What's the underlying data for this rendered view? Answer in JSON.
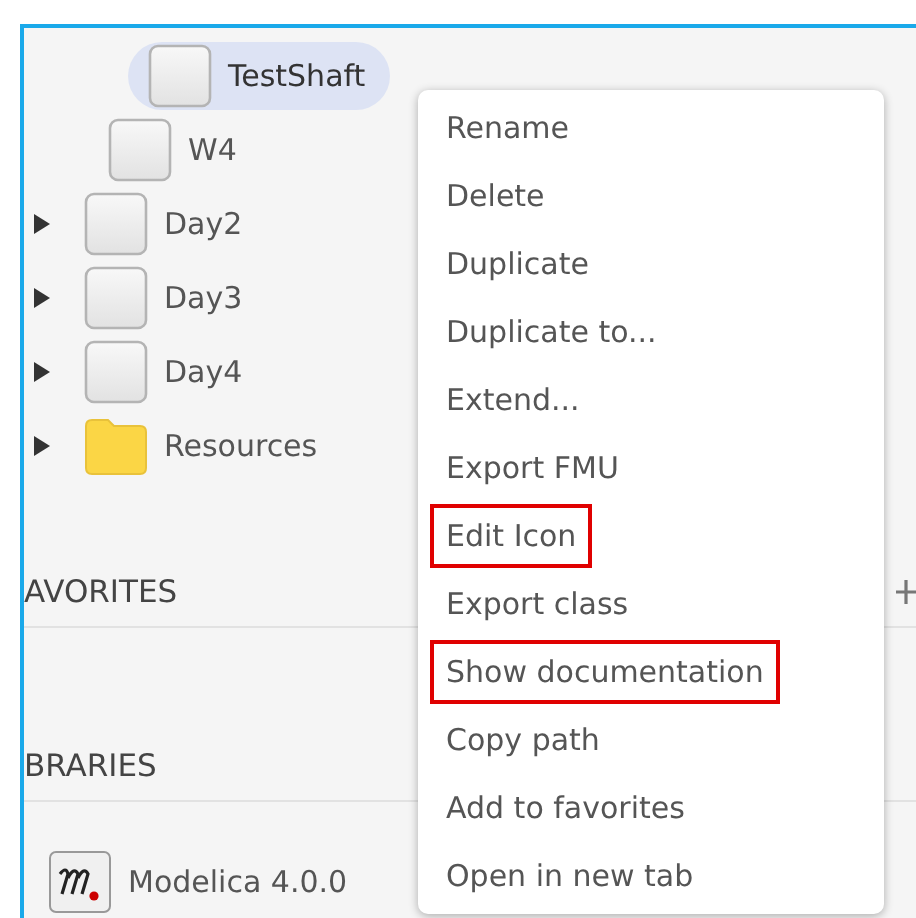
{
  "tree": [
    {
      "children": [
        {
          "children": [
            {
              "label": "TestShaft",
              "kind": "class",
              "selected": true
            }
          ]
        },
        {
          "label": "W4",
          "kind": "class",
          "selected": false
        }
      ]
    },
    {
      "label": "Day2",
      "kind": "class",
      "expanded": false,
      "selected": false
    },
    {
      "label": "Day3",
      "kind": "class",
      "expanded": false,
      "selected": false
    },
    {
      "label": "Day4",
      "kind": "class",
      "expanded": false,
      "selected": false
    },
    {
      "label": "Resources",
      "kind": "folder",
      "expanded": false,
      "selected": false
    }
  ],
  "favorites": {
    "title": "AVORITES"
  },
  "libraries": {
    "title": "BRARIES",
    "items": [
      {
        "label": "Modelica 4.0.0",
        "kind": "library"
      }
    ]
  },
  "context_menu": [
    {
      "label": "Rename",
      "highlighted": false
    },
    {
      "label": "Delete",
      "highlighted": false
    },
    {
      "label": "Duplicate",
      "highlighted": false
    },
    {
      "label": "Duplicate to...",
      "highlighted": false
    },
    {
      "label": "Extend...",
      "highlighted": false
    },
    {
      "label": "Export FMU",
      "highlighted": false
    },
    {
      "label": "Edit Icon",
      "highlighted": true
    },
    {
      "label": "Export class",
      "highlighted": false
    },
    {
      "label": "Show documentation",
      "highlighted": true
    },
    {
      "label": "Copy path",
      "highlighted": false
    },
    {
      "label": "Add to favorites",
      "highlighted": false
    },
    {
      "label": "Open in new tab",
      "highlighted": false
    }
  ]
}
